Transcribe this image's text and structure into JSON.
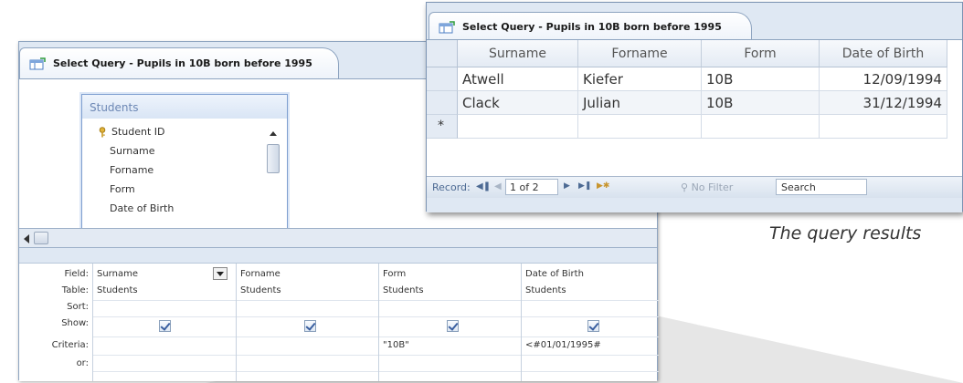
{
  "design_window": {
    "tab_title": "Select Query - Pupils in 10B born before 1995",
    "field_list": {
      "title": "Students",
      "items": [
        "Student ID",
        "Surname",
        "Forname",
        "Form",
        "Date of Birth"
      ]
    },
    "grid": {
      "row_labels": [
        "Field:",
        "Table:",
        "Sort:",
        "Show:",
        "Criteria:",
        "or:"
      ],
      "columns": [
        {
          "field": "Surname",
          "table": "Students",
          "show": true,
          "criteria": ""
        },
        {
          "field": "Forname",
          "table": "Students",
          "show": true,
          "criteria": ""
        },
        {
          "field": "Form",
          "table": "Students",
          "show": true,
          "criteria": "\"10B\""
        },
        {
          "field": "Date of Birth",
          "table": "Students",
          "show": true,
          "criteria": "<#01/01/1995#"
        }
      ]
    }
  },
  "results_window": {
    "tab_title": "Select Query - Pupils in 10B born before 1995",
    "headers": [
      "Surname",
      "Forname",
      "Form",
      "Date of Birth"
    ],
    "rows": [
      [
        "Atwell",
        "Kiefer",
        "10B",
        "12/09/1994"
      ],
      [
        "Clack",
        "Julian",
        "10B",
        "31/12/1994"
      ]
    ],
    "new_row_marker": "*",
    "nav": {
      "record_label": "Record:",
      "position": "1 of 2",
      "filter_label": "No Filter",
      "search_label": "Search"
    }
  },
  "caption": "The query results"
}
